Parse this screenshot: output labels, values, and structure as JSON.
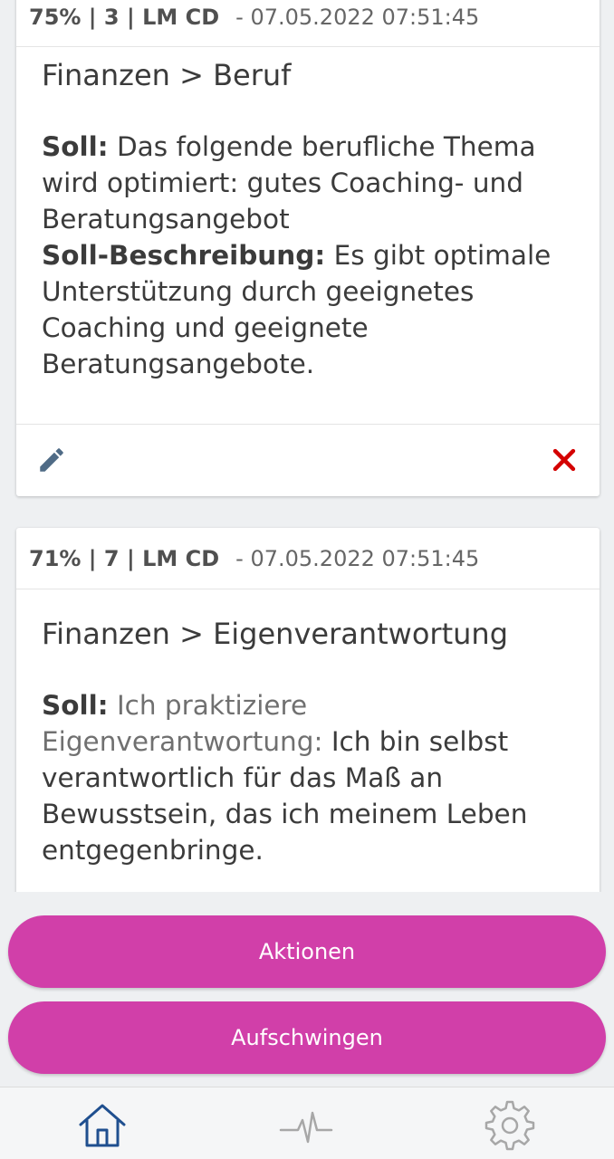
{
  "cards": [
    {
      "score": "75% | 3 | LM CD",
      "timestamp": "- 07.05.2022 07:51:45",
      "category": "Finanzen > Beruf",
      "soll_label": "Soll:",
      "soll_text": "Das folgende berufliche Thema wird optimiert: gutes Coaching- und Beratungsangebot",
      "beschreibung_label": "Soll-Beschreibung:",
      "beschreibung_text": "Es gibt optimale Unterstützung durch geeignetes Coaching und geeignete Beratungsangebote."
    },
    {
      "score": "71% | 7 | LM CD",
      "timestamp": "- 07.05.2022 07:51:45",
      "category": "Finanzen > Eigenverantwortung",
      "soll_label": "Soll:",
      "soll_muted": "Ich praktiziere Eigenverantwortung:",
      "soll_text": "Ich bin selbst verantwortlich für das Maß an Bewusstsein, das ich meinem Leben entgegenbringe."
    }
  ],
  "buttons": {
    "aktionen": "Aktionen",
    "aufschwingen": "Aufschwingen"
  },
  "icons": {
    "edit": "pencil-icon",
    "delete": "close-icon",
    "home": "home-icon",
    "pulse": "pulse-icon",
    "settings": "gear-icon"
  },
  "colors": {
    "accent": "#d13fa9",
    "delete": "#d40000",
    "nav_active": "#1f4f8f",
    "nav_inactive": "#a7a7a7"
  }
}
